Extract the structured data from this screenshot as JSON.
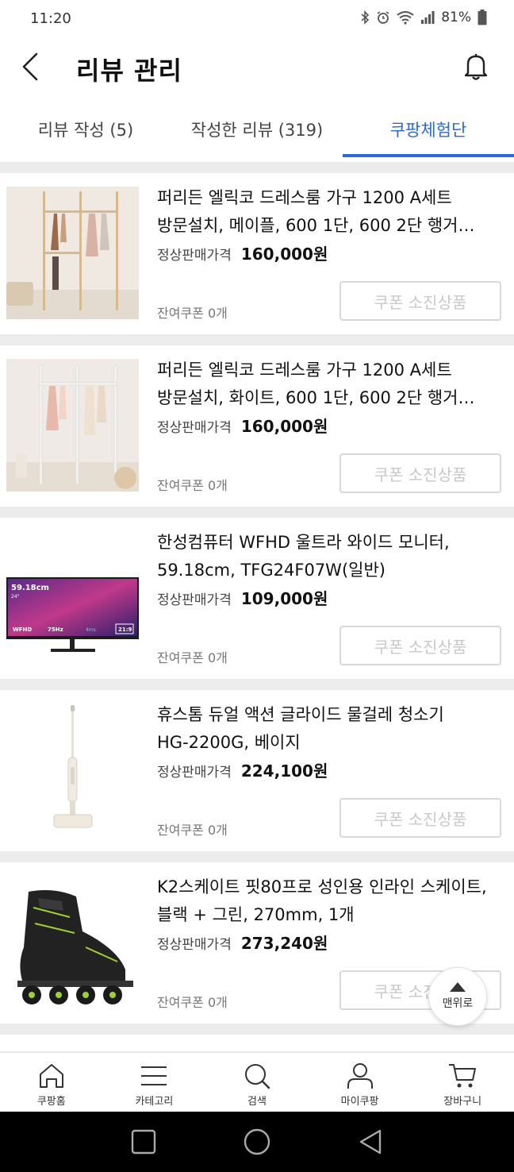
{
  "status_bar": {
    "time": "11:20",
    "battery": "81%"
  },
  "header": {
    "title": "리뷰 관리"
  },
  "tabs": [
    {
      "label": "리뷰 작성 (5)",
      "active": false
    },
    {
      "label": "작성한 리뷰 (319)",
      "active": false
    },
    {
      "label": "쿠팡체험단",
      "active": true
    }
  ],
  "items": [
    {
      "title_line1": "퍼리든 엘릭코 드레스룸 가구 1200 A세트",
      "title_line2": "방문설치, 메이플, 600 1단, 600 2단 행거…",
      "price_label": "정상판매가격",
      "price": "160,000원",
      "coupons_left": "잔여쿠폰 0개",
      "button_label": "쿠폰 소진상품"
    },
    {
      "title_line1": "퍼리든 엘릭코 드레스룸 가구 1200 A세트",
      "title_line2": "방문설치, 화이트, 600 1단, 600 2단 행거…",
      "price_label": "정상판매가격",
      "price": "160,000원",
      "coupons_left": "잔여쿠폰 0개",
      "button_label": "쿠폰 소진상품"
    },
    {
      "title_line1": "한성컴퓨터 WFHD 울트라 와이드 모니터,",
      "title_line2": "59.18cm, TFG24F07W(일반)",
      "price_label": "정상판매가격",
      "price": "109,000원",
      "coupons_left": "잔여쿠폰 0개",
      "button_label": "쿠폰 소진상품",
      "thumb_text": {
        "size": "59.18cm",
        "diag": "24\"",
        "wfhd": "WFHD",
        "hz": "75Hz",
        "ms": "4ms",
        "ratio": "21:9"
      }
    },
    {
      "title_line1": "휴스톰 듀얼 액션 글라이드 물걸레 청소기",
      "title_line2": "HG-2200G, 베이지",
      "price_label": "정상판매가격",
      "price": "224,100원",
      "coupons_left": "잔여쿠폰 0개",
      "button_label": "쿠폰 소진상품"
    },
    {
      "title_line1": "K2스케이트 핏80프로 성인용 인라인 스케이트,",
      "title_line2": "블랙 + 그린, 270mm, 1개",
      "price_label": "정상판매가격",
      "price": "273,240원",
      "coupons_left": "잔여쿠폰 0개",
      "button_label": "쿠폰 소진상품"
    }
  ],
  "scroll_top": {
    "label": "맨위로"
  },
  "bottom_nav": [
    {
      "label": "쿠팡홈",
      "icon": "home-icon"
    },
    {
      "label": "카테고리",
      "icon": "menu-icon"
    },
    {
      "label": "검색",
      "icon": "search-icon"
    },
    {
      "label": "마이쿠팡",
      "icon": "user-icon"
    },
    {
      "label": "장바구니",
      "icon": "cart-icon"
    }
  ],
  "colors": {
    "accent": "#2a6ad9",
    "divider": "#ececec",
    "disabled": "#c9c9c9"
  }
}
